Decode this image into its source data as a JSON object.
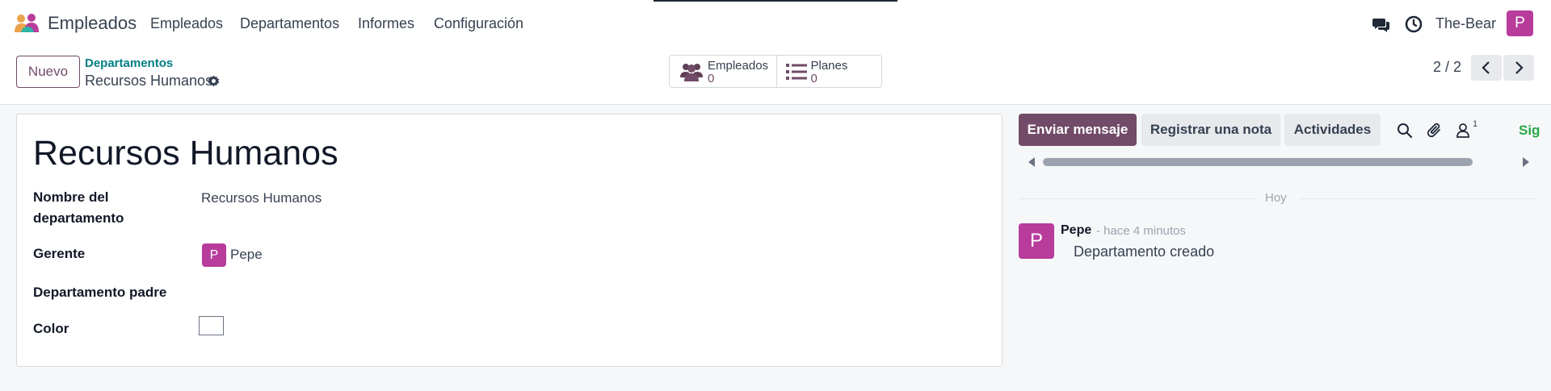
{
  "navbar": {
    "app_name": "Empleados",
    "menu": [
      "Empleados",
      "Departamentos",
      "Informes",
      "Configuración"
    ],
    "user_name": "The-Bear",
    "user_avatar_letter": "P",
    "icons": [
      "chat-icon",
      "clock-icon"
    ]
  },
  "control": {
    "new_button": "Nuevo",
    "breadcrumb_parent": "Departamentos",
    "breadcrumb_current": "Recursos Humanos",
    "smart_buttons": [
      {
        "label": "Empleados",
        "value": "0",
        "icon": "users-icon"
      },
      {
        "label": "Planes",
        "value": "0",
        "icon": "list-icon"
      }
    ],
    "pager": "2 / 2"
  },
  "form": {
    "title": "Recursos Humanos",
    "fields": {
      "name_label_line1": "Nombre del",
      "name_label_line2": "departamento",
      "name_value": "Recursos Humanos",
      "manager_label": "Gerente",
      "manager_value": "Pepe",
      "manager_avatar_letter": "P",
      "parent_label": "Departamento padre",
      "color_label": "Color"
    }
  },
  "chatter": {
    "send_message": "Enviar mensaje",
    "log_note": "Registrar una nota",
    "activities": "Actividades",
    "followers_count": "1",
    "follow_label": "Sig",
    "date_separator": "Hoy",
    "messages": [
      {
        "author": "Pepe",
        "time": "- hace 4 minutos",
        "body": "Departamento creado",
        "avatar_letter": "P"
      }
    ]
  },
  "colors": {
    "brand": "#714b67",
    "avatar": "#b83c9b",
    "link": "#017e84",
    "follow": "#28a745"
  }
}
